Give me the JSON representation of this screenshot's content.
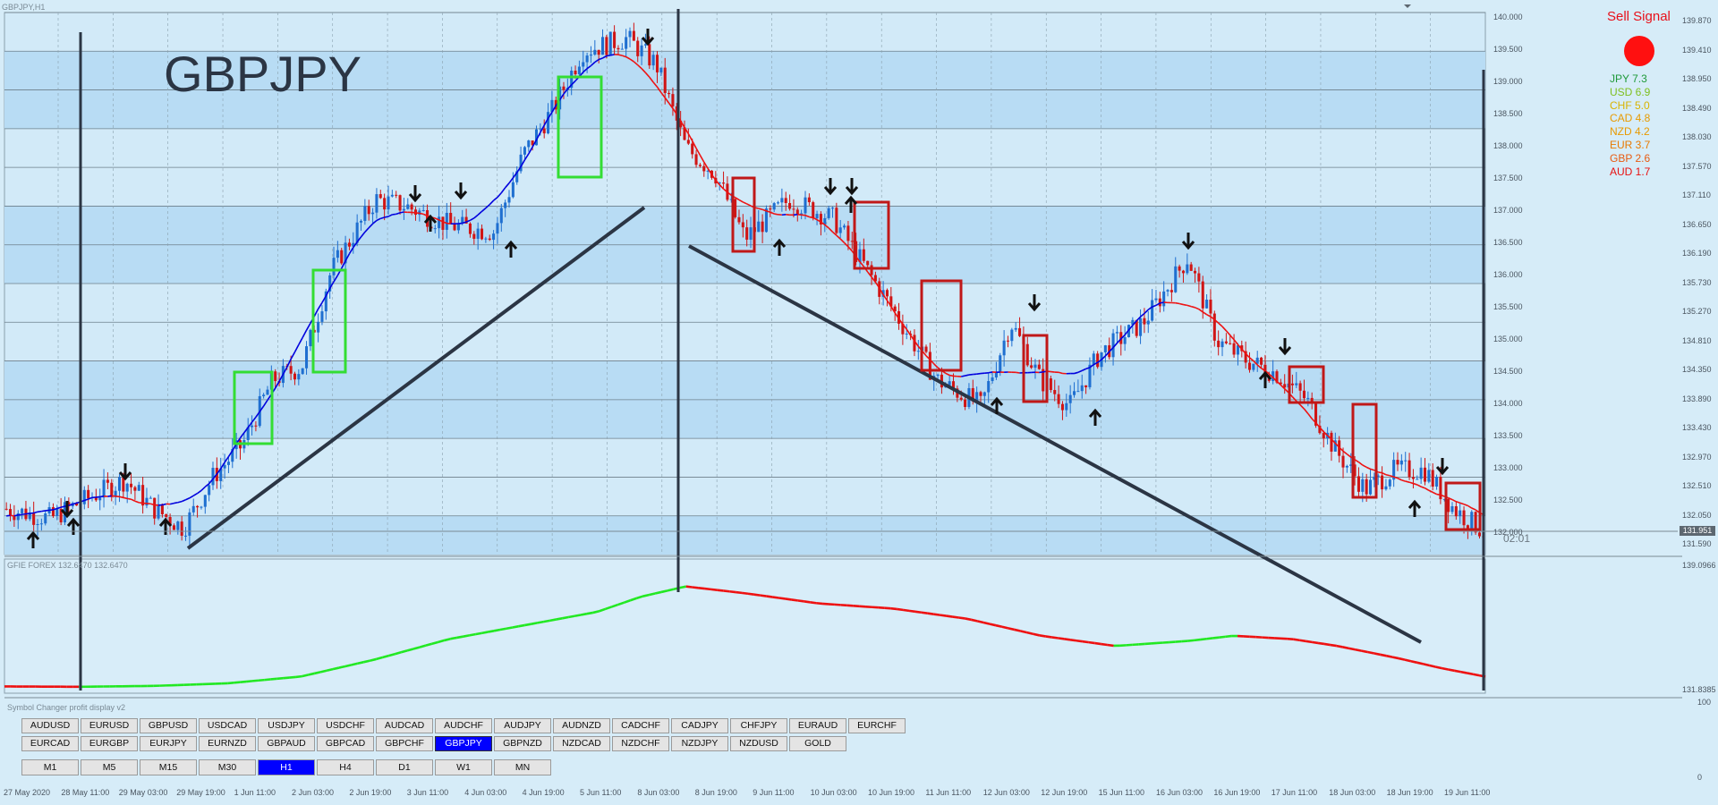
{
  "window": {
    "title": "GBPJPY,H1"
  },
  "symbol_label": "GBPJPY",
  "chart_data": {
    "type": "candlestick",
    "symbol": "GBPJPY",
    "timeframe": "H1",
    "ylim": [
      131.59,
      140.0
    ],
    "price_ticks_left": [
      "140.000",
      "139.500",
      "139.000",
      "138.500",
      "138.000",
      "137.500",
      "137.000",
      "136.500",
      "136.000",
      "135.500",
      "135.000",
      "134.500",
      "134.000",
      "133.500",
      "133.000",
      "132.500",
      "132.000"
    ],
    "price_ticks_right": [
      "139.870",
      "139.410",
      "138.950",
      "138.490",
      "138.030",
      "137.570",
      "137.110",
      "136.650",
      "136.190",
      "135.730",
      "135.270",
      "134.810",
      "134.350",
      "133.890",
      "133.430",
      "132.970",
      "132.510",
      "132.050",
      "131.590"
    ],
    "current_price": "131.951",
    "time_to_close": "02:01",
    "x_labels": [
      "27 May 2020",
      "28 May 11:00",
      "29 May 03:00",
      "29 May 19:00",
      "1 Jun 11:00",
      "2 Jun 03:00",
      "2 Jun 19:00",
      "3 Jun 11:00",
      "4 Jun 03:00",
      "4 Jun 19:00",
      "5 Jun 11:00",
      "8 Jun 03:00",
      "8 Jun 19:00",
      "9 Jun 11:00",
      "10 Jun 03:00",
      "10 Jun 19:00",
      "11 Jun 11:00",
      "12 Jun 03:00",
      "12 Jun 19:00",
      "15 Jun 11:00",
      "16 Jun 03:00",
      "16 Jun 19:00",
      "17 Jun 11:00",
      "18 Jun 03:00",
      "18 Jun 19:00",
      "19 Jun 11:00"
    ],
    "price_path": [
      [
        0,
        132.3
      ],
      [
        0.03,
        132.15
      ],
      [
        0.05,
        132.4
      ],
      [
        0.08,
        132.75
      ],
      [
        0.1,
        132.3
      ],
      [
        0.12,
        132.0
      ],
      [
        0.14,
        132.8
      ],
      [
        0.16,
        133.3
      ],
      [
        0.18,
        134.3
      ],
      [
        0.2,
        134.5
      ],
      [
        0.22,
        136.0
      ],
      [
        0.25,
        137.1
      ],
      [
        0.27,
        137.0
      ],
      [
        0.3,
        136.7
      ],
      [
        0.33,
        136.6
      ],
      [
        0.35,
        137.8
      ],
      [
        0.37,
        138.5
      ],
      [
        0.39,
        139.4
      ],
      [
        0.42,
        139.6
      ],
      [
        0.44,
        139.2
      ],
      [
        0.46,
        137.9
      ],
      [
        0.48,
        137.5
      ],
      [
        0.5,
        136.5
      ],
      [
        0.53,
        137.1
      ],
      [
        0.56,
        136.8
      ],
      [
        0.58,
        136.1
      ],
      [
        0.6,
        135.4
      ],
      [
        0.63,
        134.3
      ],
      [
        0.66,
        133.9
      ],
      [
        0.68,
        135.2
      ],
      [
        0.7,
        134.3
      ],
      [
        0.72,
        133.9
      ],
      [
        0.74,
        134.7
      ],
      [
        0.77,
        135.2
      ],
      [
        0.8,
        136.2
      ],
      [
        0.82,
        134.9
      ],
      [
        0.84,
        134.6
      ],
      [
        0.86,
        134.4
      ],
      [
        0.88,
        134.0
      ],
      [
        0.9,
        133.2
      ],
      [
        0.92,
        132.6
      ],
      [
        0.94,
        132.9
      ],
      [
        0.96,
        132.9
      ],
      [
        0.98,
        132.3
      ],
      [
        1,
        131.95
      ]
    ],
    "indicator": {
      "name": "GFIE FOREX",
      "values_label": "132.6470 132.6470",
      "ylim": [
        131.8385,
        139.0966
      ],
      "y_ticks": [
        "139.0966",
        "131.8385"
      ],
      "path": [
        [
          0,
          131.92
        ],
        [
          0.05,
          131.9
        ],
        [
          0.1,
          131.95
        ],
        [
          0.15,
          132.1
        ],
        [
          0.2,
          132.5
        ],
        [
          0.25,
          133.5
        ],
        [
          0.3,
          134.7
        ],
        [
          0.35,
          135.5
        ],
        [
          0.4,
          136.3
        ],
        [
          0.43,
          137.2
        ],
        [
          0.46,
          137.8
        ],
        [
          0.5,
          137.4
        ],
        [
          0.55,
          136.8
        ],
        [
          0.6,
          136.5
        ],
        [
          0.65,
          135.9
        ],
        [
          0.7,
          134.9
        ],
        [
          0.75,
          134.3
        ],
        [
          0.8,
          134.6
        ],
        [
          0.83,
          134.9
        ],
        [
          0.87,
          134.7
        ],
        [
          0.9,
          134.3
        ],
        [
          0.94,
          133.6
        ],
        [
          0.97,
          133.0
        ],
        [
          1,
          132.5
        ]
      ],
      "up_color": "#22e822",
      "down_color": "#ee1111"
    },
    "ma_up_color": "#0000dd",
    "ma_down_color": "#ee1111"
  },
  "signal_panel": {
    "title": "Sell Signal",
    "dot_color": "#ff1010",
    "strength": [
      {
        "label": "JPY 7.3",
        "color": "#1f9a3a"
      },
      {
        "label": "USD 6.9",
        "color": "#7fbf1f"
      },
      {
        "label": "CHF 5.0",
        "color": "#d9b300"
      },
      {
        "label": "CAD 4.8",
        "color": "#e89a00"
      },
      {
        "label": "NZD 4.2",
        "color": "#e89a00"
      },
      {
        "label": "EUR 3.7",
        "color": "#e87a00"
      },
      {
        "label": "GBP 2.6",
        "color": "#e85a10"
      },
      {
        "label": "AUD 1.7",
        "color": "#e81010"
      }
    ]
  },
  "symbol_changer": {
    "title": "Symbol Changer profit display v2",
    "row1": [
      "AUDUSD",
      "EURUSD",
      "GBPUSD",
      "USDCAD",
      "USDJPY",
      "USDCHF",
      "AUDCAD",
      "AUDCHF",
      "AUDJPY",
      "AUDNZD",
      "CADCHF",
      "CADJPY",
      "CHFJPY",
      "EURAUD",
      "EURCHF"
    ],
    "row2": [
      "EURCAD",
      "EURGBP",
      "EURJPY",
      "EURNZD",
      "GBPAUD",
      "GBPCAD",
      "GBPCHF",
      "GBPJPY",
      "GBPNZD",
      "NZDCAD",
      "NZDCHF",
      "NZDJPY",
      "NZDUSD",
      "GOLD"
    ],
    "active_symbol": "GBPJPY",
    "timeframes": [
      "M1",
      "M5",
      "M15",
      "M30",
      "H1",
      "H4",
      "D1",
      "W1",
      "MN"
    ],
    "active_timeframe": "H1"
  },
  "panel_axis": {
    "top": "100",
    "bottom": "0"
  }
}
